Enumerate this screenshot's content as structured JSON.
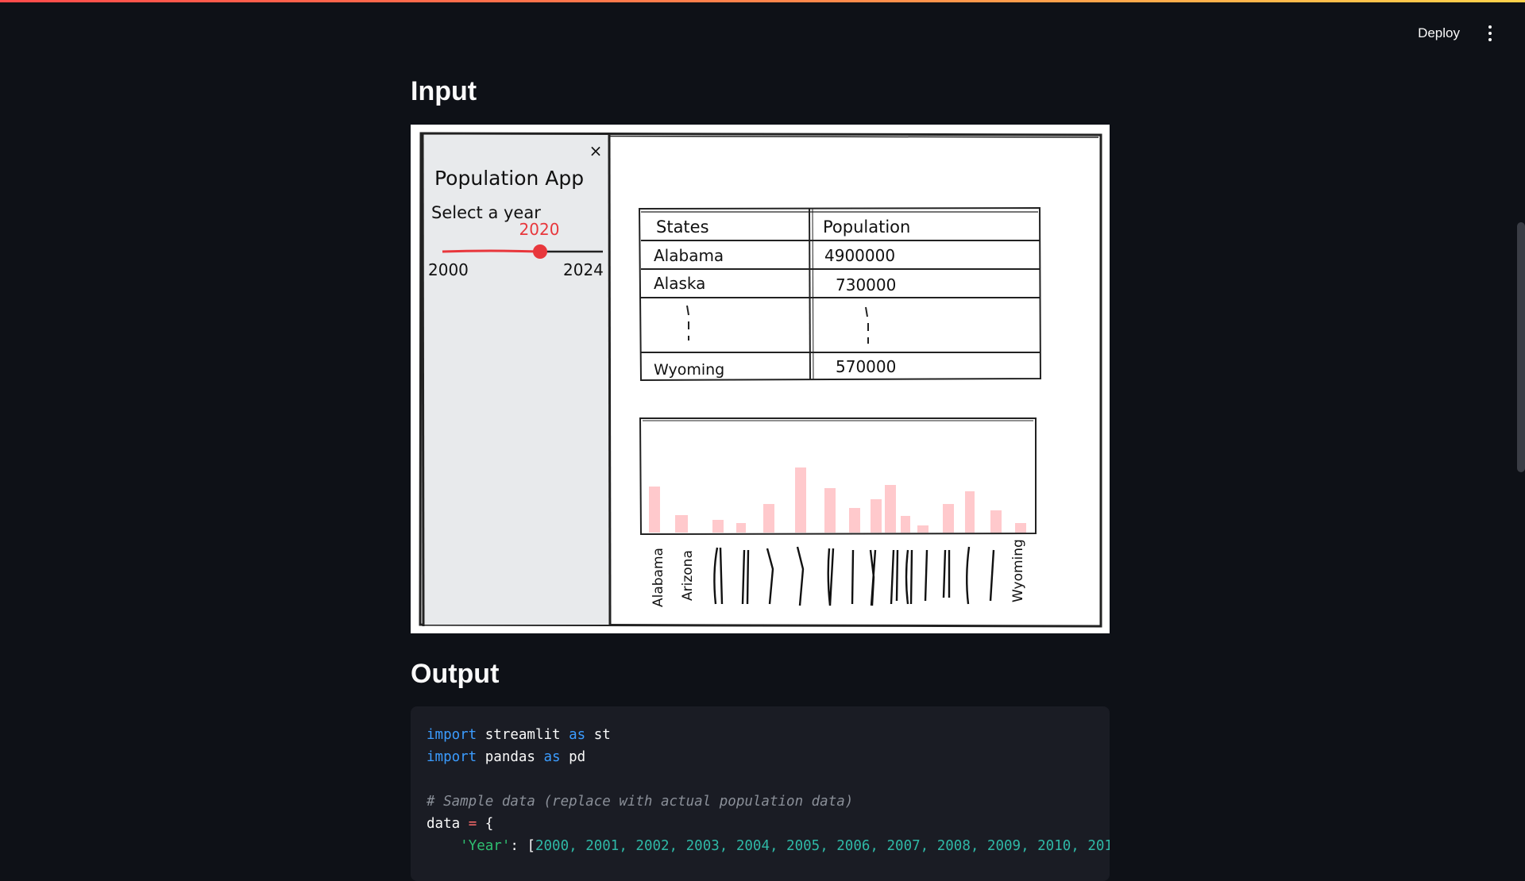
{
  "header": {
    "deploy_label": "Deploy"
  },
  "sections": {
    "input_title": "Input",
    "output_title": "Output"
  },
  "sketch": {
    "app_title": "Population App",
    "slider_label": "Select a year",
    "slider_value": "2020",
    "slider_min": "2000",
    "slider_max": "2024",
    "close_glyph": "×",
    "table": {
      "headers": [
        "States",
        "Population"
      ],
      "rows": [
        [
          "Alabama",
          "4900000"
        ],
        [
          "Alaska",
          "730000"
        ],
        [
          "Wyoming",
          "570000"
        ]
      ]
    },
    "bar_labels": [
      "Alabama",
      "Arizona",
      "Wyoming"
    ],
    "bar_color": "#ffc9cc",
    "accent": "#e8373c"
  },
  "code": {
    "line1_kw1": "import",
    "line1_mod": " streamlit ",
    "line1_kw2": "as",
    "line1_alias": " st",
    "line2_kw1": "import",
    "line2_mod": " pandas ",
    "line2_kw2": "as",
    "line2_alias": " pd",
    "line4_comment": "# Sample data (replace with actual population data)",
    "line5_var": "data ",
    "line5_op": "=",
    "line5_brace": " {",
    "line6_indent": "    ",
    "line6_key": "'Year'",
    "line6_colon": ": [",
    "line6_years": "2000, 2001, 2002, 2003, 2004, 2005, 2006, 2007, 2008, 2009, 2010, 201"
  }
}
